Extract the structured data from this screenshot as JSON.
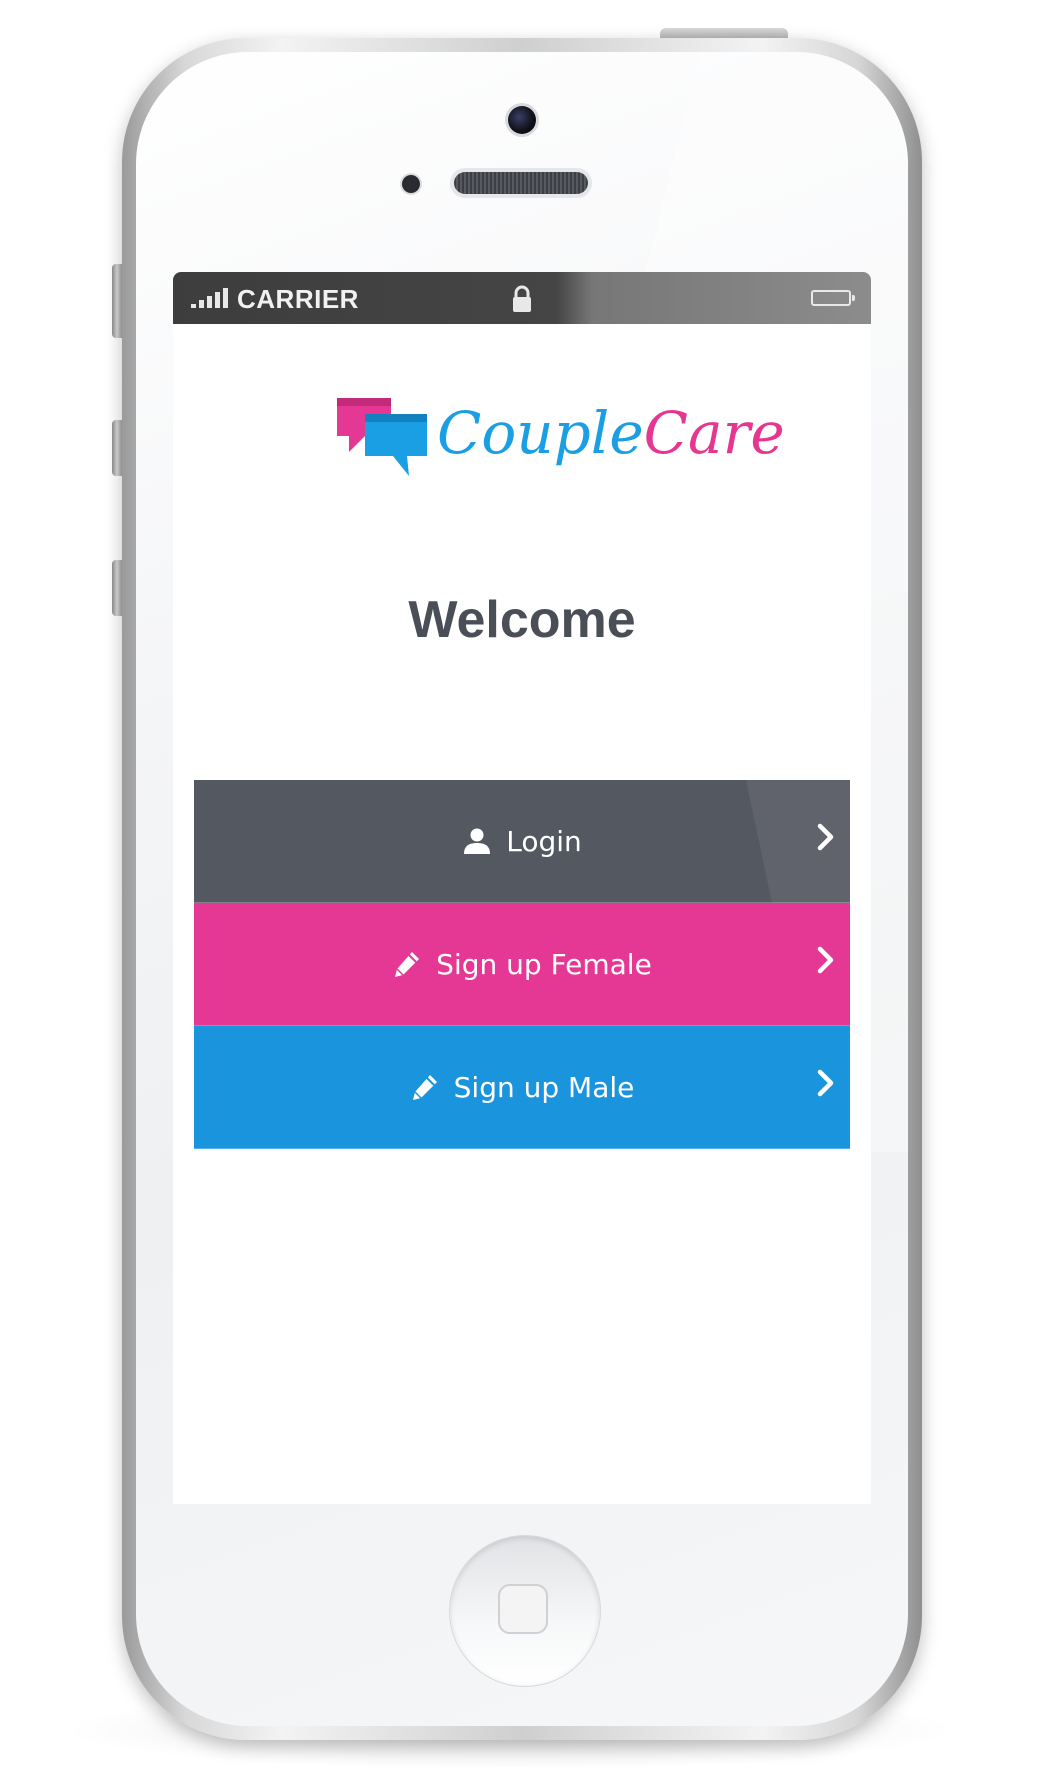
{
  "status_bar": {
    "carrier": "CARRIER"
  },
  "logo": {
    "word1": "Couple",
    "word2": "Care",
    "colors": {
      "primary": "#1a9ee4",
      "secondary": "#e5378f"
    }
  },
  "welcome": {
    "title": "Welcome"
  },
  "menu": {
    "login": {
      "label": "Login",
      "icon": "user-icon",
      "color": "#545860"
    },
    "signup_female": {
      "label": "Sign up Female",
      "icon": "pencil-icon",
      "color": "#e43894"
    },
    "signup_male": {
      "label": "Sign up Male",
      "icon": "pencil-icon",
      "color": "#1b94de"
    }
  }
}
